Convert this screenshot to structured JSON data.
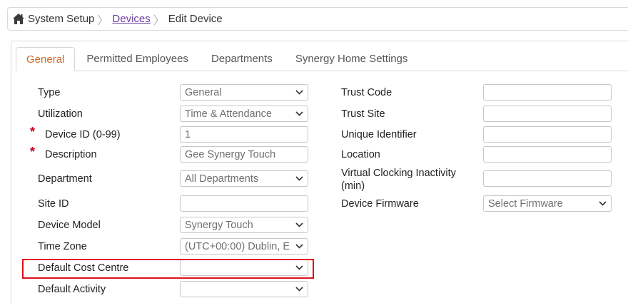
{
  "breadcrumb": {
    "home_icon": "home-icon",
    "items": [
      "System Setup",
      "Devices",
      "Edit Device"
    ]
  },
  "tabs": [
    "General",
    "Permitted Employees",
    "Departments",
    "Synergy Home Settings"
  ],
  "active_tab": "General",
  "left_fields": [
    {
      "label": "Type",
      "type": "select",
      "value": "General",
      "required": false
    },
    {
      "label": "Utilization",
      "type": "select",
      "value": "Time & Attendance",
      "required": false
    },
    {
      "label": "Device ID (0-99)",
      "type": "input",
      "value": "1",
      "required": true
    },
    {
      "label": "Description",
      "type": "input",
      "value": "Gee Synergy Touch",
      "required": true
    },
    {
      "label": "Department",
      "type": "select",
      "value": "All Departments",
      "required": false
    },
    {
      "label": "Site ID",
      "type": "input",
      "value": "",
      "required": false
    },
    {
      "label": "Device Model",
      "type": "select",
      "value": "Synergy Touch",
      "required": false
    },
    {
      "label": "Time Zone",
      "type": "select",
      "value": "(UTC+00:00) Dublin, E",
      "required": false
    },
    {
      "label": "Default Cost Centre",
      "type": "select",
      "value": "",
      "required": false
    },
    {
      "label": "Default Activity",
      "type": "select",
      "value": "",
      "required": false
    }
  ],
  "right_fields": [
    {
      "label": "Trust Code",
      "type": "input",
      "value": ""
    },
    {
      "label": "Trust Site",
      "type": "input",
      "value": ""
    },
    {
      "label": "Unique Identifier",
      "type": "input",
      "value": ""
    },
    {
      "label": "Location",
      "type": "input",
      "value": ""
    },
    {
      "label": "Virtual Clocking Inactivity (min)",
      "type": "input",
      "value": ""
    },
    {
      "label": "Device Firmware",
      "type": "select",
      "value": "Select Firmware"
    }
  ],
  "colors": {
    "accent": "#d2691e",
    "required": "#d0021b",
    "highlight": "#e0101a",
    "link": "#6a3fa0"
  }
}
